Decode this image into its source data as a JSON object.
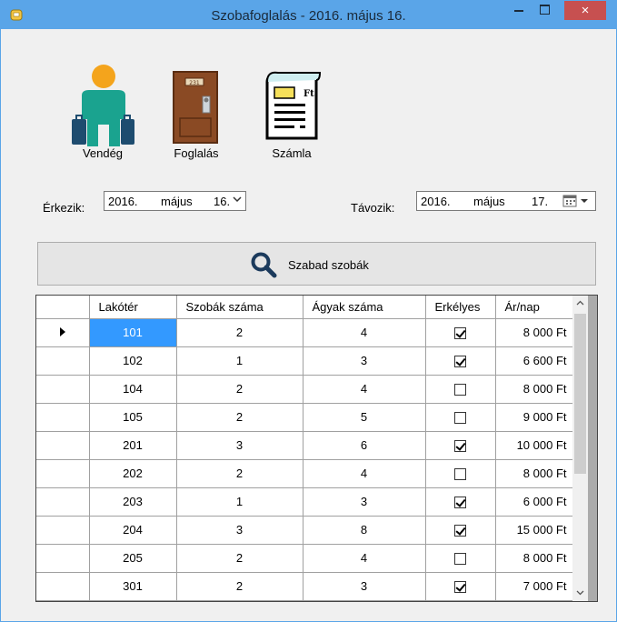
{
  "window": {
    "title": "Szobafoglalás - 2016. május 16.",
    "close_label": "×"
  },
  "toolbar": {
    "guest": {
      "label": "Vendég",
      "icon": "guest-icon"
    },
    "booking": {
      "label": "Foglalás",
      "icon": "door-icon",
      "door_number": "231"
    },
    "invoice": {
      "label": "Számla",
      "icon": "invoice-icon",
      "currency": "Ft"
    }
  },
  "arrival": {
    "label": "Érkezik:",
    "year": "2016.",
    "month": "május",
    "day": "16."
  },
  "departure": {
    "label": "Távozik:",
    "year": "2016.",
    "month": "május",
    "day": "17."
  },
  "search_button": {
    "label": "Szabad szobák",
    "icon": "magnifier-icon"
  },
  "grid": {
    "columns": [
      "Lakótér",
      "Szobák száma",
      "Ágyak száma",
      "Erkélyes",
      "Ár/nap"
    ],
    "rows": [
      {
        "room": "101",
        "rooms": "2",
        "beds": "4",
        "balcony": true,
        "price": "8 000 Ft"
      },
      {
        "room": "102",
        "rooms": "1",
        "beds": "3",
        "balcony": true,
        "price": "6 600 Ft"
      },
      {
        "room": "104",
        "rooms": "2",
        "beds": "4",
        "balcony": false,
        "price": "8 000 Ft"
      },
      {
        "room": "105",
        "rooms": "2",
        "beds": "5",
        "balcony": false,
        "price": "9 000 Ft"
      },
      {
        "room": "201",
        "rooms": "3",
        "beds": "6",
        "balcony": true,
        "price": "10 000 Ft"
      },
      {
        "room": "202",
        "rooms": "2",
        "beds": "4",
        "balcony": false,
        "price": "8 000 Ft"
      },
      {
        "room": "203",
        "rooms": "1",
        "beds": "3",
        "balcony": true,
        "price": "6 000 Ft"
      },
      {
        "room": "204",
        "rooms": "3",
        "beds": "8",
        "balcony": true,
        "price": "15 000 Ft"
      },
      {
        "room": "205",
        "rooms": "2",
        "beds": "4",
        "balcony": false,
        "price": "8 000 Ft"
      },
      {
        "room": "301",
        "rooms": "2",
        "beds": "3",
        "balcony": true,
        "price": "7 000 Ft"
      }
    ],
    "selected_row": 0
  },
  "colors": {
    "titlebar": "#5aa5e8",
    "selection": "#3399ff",
    "close": "#c75050"
  }
}
